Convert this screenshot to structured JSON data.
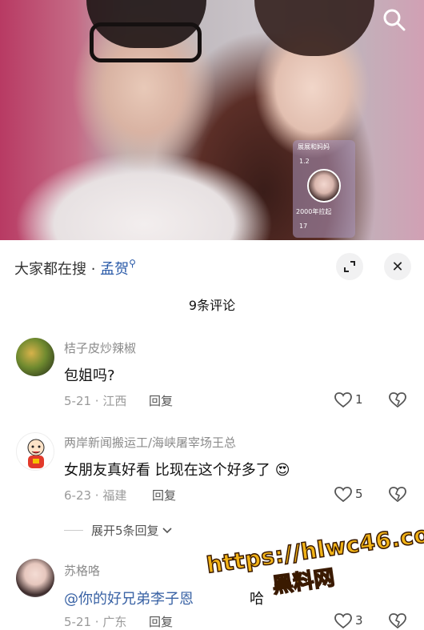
{
  "video": {
    "card_title": "展展和妈妈",
    "card_count": "1.2",
    "card_caption": "2000年拉起",
    "card_count2": "17"
  },
  "sheet": {
    "hot_search_prefix": "大家都在搜 · ",
    "hot_search_keyword": "孟贺",
    "comment_count": "9条评论",
    "close_glyph": "✕"
  },
  "comments": [
    {
      "user": "桔子皮炒辣椒",
      "text": "包姐吗?",
      "meta": "5-21 · 江西",
      "reply": "回复",
      "likes": "1"
    },
    {
      "user": "两岸新闻搬运工/海峡屠宰场王总",
      "text": "女朋友真好看 比现在这个好多了",
      "emoji": "😍",
      "meta": "6-23 · 福建",
      "reply": "回复",
      "likes": "5"
    },
    {
      "user": "苏格咯",
      "text": "@你的好兄弟李子恩",
      "text_tail": "哈",
      "meta": "5-21 · 广东",
      "reply": "回复",
      "likes": "3"
    }
  ],
  "expand_replies": "展开5条回复",
  "watermark": {
    "url": "https://hlwc46.com",
    "sub": "黑料网"
  },
  "colors": {
    "link_blue": "#2a5aa8",
    "watermark_gold": "#f2b316"
  }
}
